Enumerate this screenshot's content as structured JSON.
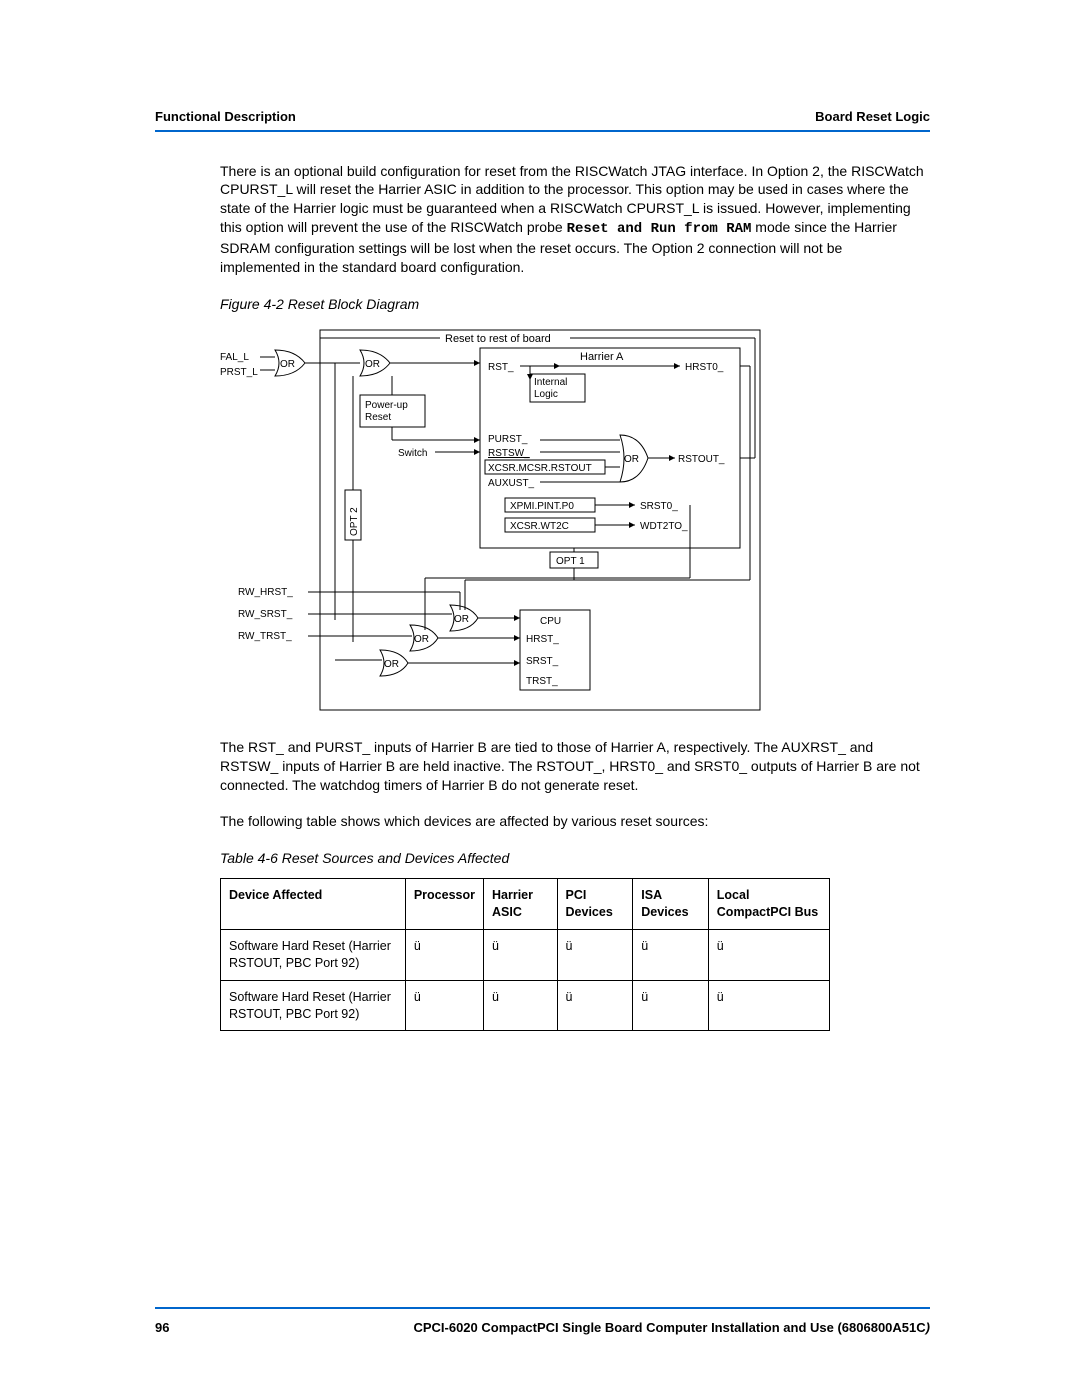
{
  "header": {
    "left": "Functional Description",
    "right": "Board Reset Logic"
  },
  "body": {
    "p1_a": "There is an optional build configuration for reset from the RISCWatch JTAG interface. In Option 2, the RISCWatch CPURST_L will reset the Harrier ASIC in addition to the processor. This option may be used in cases where the state of the Harrier logic must be guaranteed when a RISCWatch CPURST_L is issued. However, implementing this option will prevent the use of the RISCWatch probe ",
    "p1_mono": "Reset and Run from RAM",
    "p1_b": " mode since the Harrier SDRAM configuration settings will be lost when the reset occurs. The Option 2 connection will not be implemented in the standard board configuration.",
    "fig_caption": "Figure 4-2    Reset Block Diagram",
    "p2": "The RST_ and PURST_ inputs of Harrier B are tied to those of Harrier A, respectively. The AUXRST_ and RSTSW_ inputs of Harrier B are held inactive. The RSTOUT_, HRST0_ and SRST0_ outputs of Harrier B are not connected. The watchdog timers of Harrier B do not generate reset.",
    "p3": "The following table shows which devices are affected by various reset sources:",
    "tbl_caption": "Table 4-6 Reset Sources and Devices Affected"
  },
  "diagram": {
    "reset_rest": "Reset to rest of board",
    "fal_l": "FAL_L",
    "prst_l": "PRST_L",
    "or": "OR",
    "powerup": "Power-up\nReset",
    "switch": "Switch",
    "opt2": "OPT 2",
    "opt1": "OPT 1",
    "harrier_a": "Harrier A",
    "rst": "RST_",
    "internal": "Internal\nLogic",
    "hrst0": "HRST0_",
    "purst": "PURST_",
    "rstsw": "RSTSW_",
    "xcsr_rstout": "XCSR.MCSR.RSTOUT",
    "auxust": "AUXUST_",
    "rstout": "RSTOUT_",
    "xpmi": "XPMI.PINT.P0",
    "srst0": "SRST0_",
    "xcsr_wt2c": "XCSR.WT2C",
    "wdt2to": "WDT2TO_",
    "rw_hrst": "RW_HRST_",
    "rw_srst": "RW_SRST_",
    "rw_trst": "RW_TRST_",
    "cpu": "CPU",
    "hrst": "HRST_",
    "srst": "SRST_",
    "trst": "TRST_"
  },
  "table": {
    "headers": [
      "Device Affected",
      "Processor",
      "Harrier ASIC",
      "PCI Devices",
      "ISA Devices",
      "Local CompactPCI Bus"
    ],
    "rows": [
      [
        "Software Hard Reset (Harrier RSTOUT, PBC Port 92)",
        "ü",
        "ü",
        "ü",
        "ü",
        "ü"
      ],
      [
        "Software Hard Reset (Harrier RSTOUT, PBC Port 92)",
        "ü",
        "ü",
        "ü",
        "ü",
        "ü"
      ]
    ]
  },
  "footer": {
    "page": "96",
    "title": "CPCI-6020 CompactPCI Single Board Computer Installation and Use (6806800A51C",
    "title_suffix": ")"
  }
}
